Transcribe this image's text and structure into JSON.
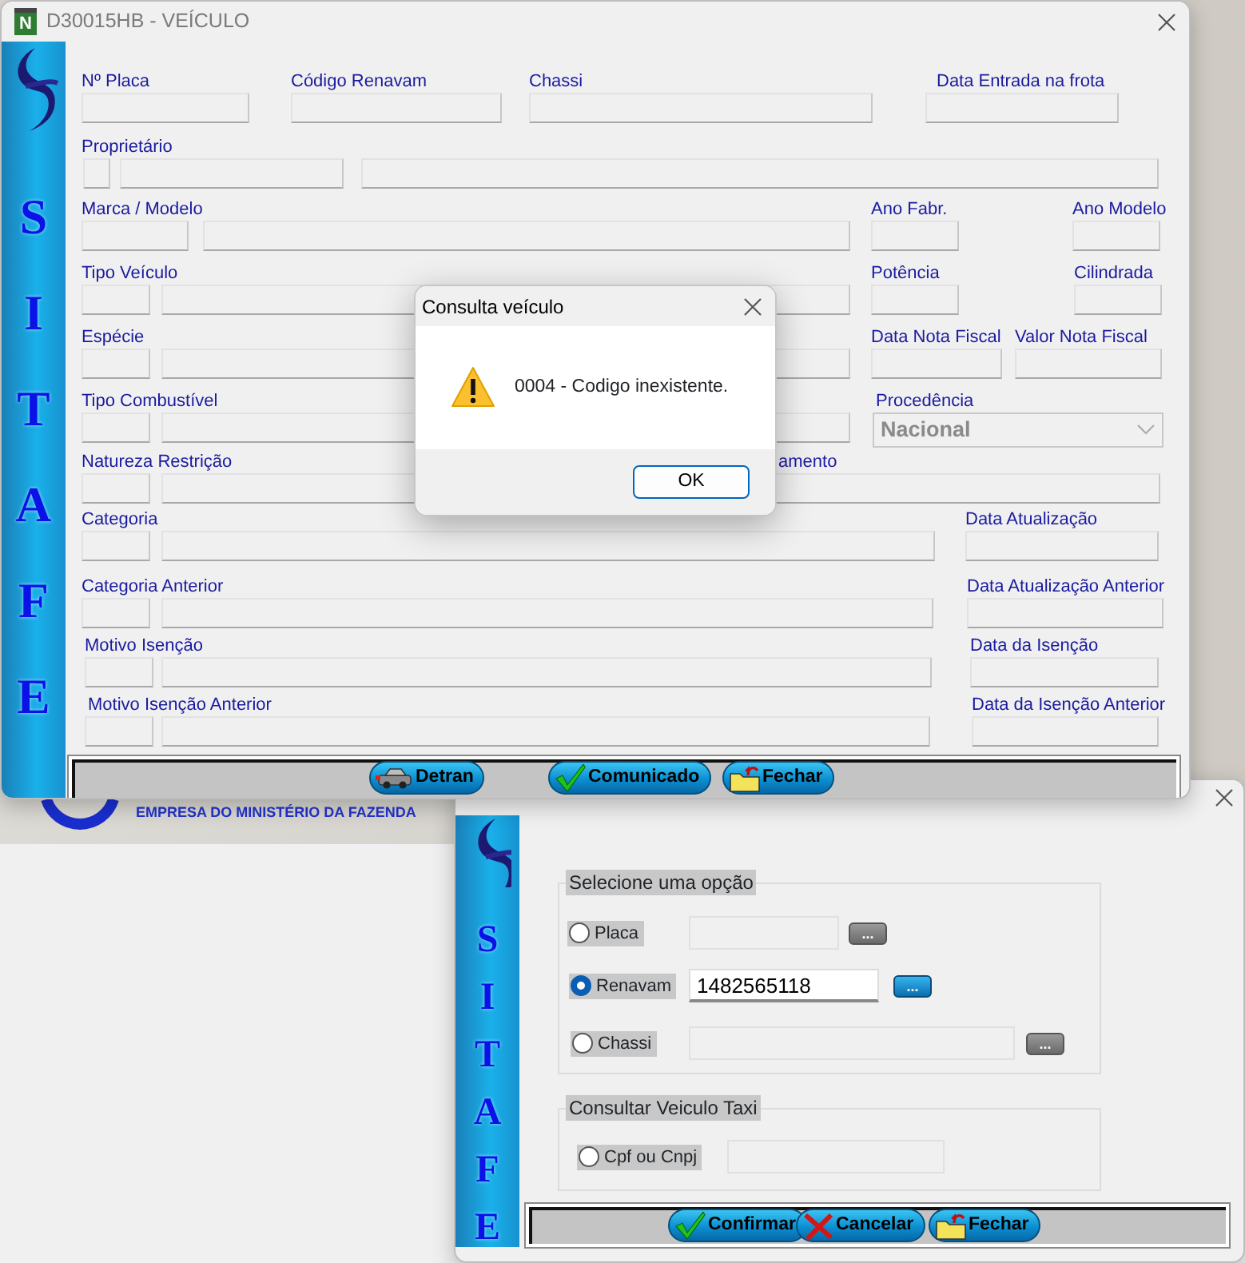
{
  "background_app": {
    "footer_text": "EMPRESA DO MINISTÉRIO DA FAZENDA"
  },
  "vehicle_window": {
    "app_icon_letter": "N",
    "title": "D30015HB - VEÍCULO",
    "brand_letters": [
      "S",
      "I",
      "T",
      "A",
      "F",
      "E"
    ],
    "rows": [
      {
        "groups": [
          {
            "label": "Nº Placa",
            "fields": [
              {
                "kind": "text"
              }
            ]
          },
          {
            "label": "Código Renavam",
            "fields": [
              {
                "kind": "text"
              }
            ]
          },
          {
            "label": "Chassi",
            "fields": [
              {
                "kind": "text"
              }
            ]
          },
          {
            "label": "Data Entrada na frota",
            "fields": [
              {
                "kind": "text"
              }
            ]
          }
        ]
      },
      {
        "groups": [
          {
            "label": "Proprietário",
            "fields": [
              {
                "kind": "text"
              },
              {
                "kind": "text"
              },
              {
                "kind": "text"
              }
            ]
          }
        ]
      },
      {
        "groups": [
          {
            "label": "Marca / Modelo",
            "fields": [
              {
                "kind": "text"
              },
              {
                "kind": "text"
              }
            ]
          },
          {
            "label": "Ano Fabr.",
            "fields": [
              {
                "kind": "text"
              }
            ]
          },
          {
            "label": "Ano Modelo",
            "fields": [
              {
                "kind": "text"
              }
            ]
          }
        ]
      },
      {
        "groups": [
          {
            "label": "Tipo Veículo",
            "fields": [
              {
                "kind": "text"
              },
              {
                "kind": "text"
              }
            ]
          },
          {
            "label": "Potência",
            "fields": [
              {
                "kind": "text"
              }
            ]
          },
          {
            "label": "Cilindrada",
            "fields": [
              {
                "kind": "text"
              }
            ]
          }
        ]
      },
      {
        "groups": [
          {
            "label": "Espécie",
            "fields": [
              {
                "kind": "text"
              },
              {
                "kind": "text"
              }
            ]
          },
          {
            "label": "Data Nota Fiscal",
            "fields": [
              {
                "kind": "text"
              }
            ]
          },
          {
            "label": "Valor Nota Fiscal",
            "fields": [
              {
                "kind": "text"
              }
            ]
          }
        ]
      },
      {
        "groups": [
          {
            "label": "Tipo Combustível",
            "fields": [
              {
                "kind": "text"
              },
              {
                "kind": "text"
              }
            ]
          },
          {
            "label": "Procedência",
            "fields": [
              {
                "kind": "select",
                "value": "Nacional"
              }
            ]
          }
        ]
      },
      {
        "groups": [
          {
            "label": "Natureza Restrição",
            "fields": [
              {
                "kind": "text"
              },
              {
                "kind": "text"
              }
            ]
          },
          {
            "label": "amento",
            "fields": [
              {
                "kind": "text"
              }
            ]
          }
        ]
      },
      {
        "groups": [
          {
            "label": "Categoria",
            "fields": [
              {
                "kind": "text"
              },
              {
                "kind": "text"
              }
            ]
          },
          {
            "label": "Data Atualização",
            "fields": [
              {
                "kind": "text"
              }
            ]
          }
        ]
      },
      {
        "groups": [
          {
            "label": "Categoria Anterior",
            "fields": [
              {
                "kind": "text"
              },
              {
                "kind": "text"
              }
            ]
          },
          {
            "label": "Data Atualização Anterior",
            "fields": [
              {
                "kind": "text"
              }
            ]
          }
        ]
      },
      {
        "groups": [
          {
            "label": "Motivo Isenção",
            "fields": [
              {
                "kind": "text"
              },
              {
                "kind": "text"
              }
            ]
          },
          {
            "label": "Data da Isenção",
            "fields": [
              {
                "kind": "text"
              }
            ]
          }
        ]
      },
      {
        "groups": [
          {
            "label": "Motivo Isenção Anterior",
            "fields": [
              {
                "kind": "text"
              },
              {
                "kind": "text"
              }
            ]
          },
          {
            "label": "Data da Isenção Anterior",
            "fields": [
              {
                "kind": "text"
              }
            ]
          }
        ]
      }
    ],
    "buttons": [
      {
        "label": "Detran"
      },
      {
        "label": "Comunicado"
      },
      {
        "label": "Fechar"
      }
    ]
  },
  "dialog": {
    "title": "Consulta veículo",
    "message": "0004 - Codigo inexistente.",
    "button": "OK"
  },
  "search_window": {
    "brand_letters": [
      "S",
      "I",
      "T",
      "A",
      "F",
      "E"
    ],
    "groups": [
      {
        "title": "Selecione uma opção",
        "options": [
          {
            "label": "Placa",
            "selected": false,
            "disabled": true,
            "button": "..."
          },
          {
            "label": "Renavam",
            "selected": true,
            "disabled": false,
            "value": "1482565118",
            "button": "..."
          },
          {
            "label": "Chassi",
            "selected": false,
            "disabled": true,
            "button": "..."
          }
        ]
      },
      {
        "title": "Consultar Veiculo Taxi",
        "options": [
          {
            "label": "Cpf ou Cnpj",
            "selected": false,
            "disabled": true
          }
        ]
      }
    ],
    "buttons": [
      {
        "label": "Confirmar"
      },
      {
        "label": "Cancelar"
      },
      {
        "label": "Fechar"
      }
    ]
  }
}
